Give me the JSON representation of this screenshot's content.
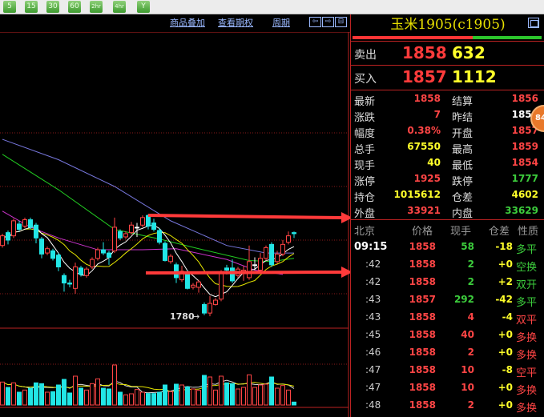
{
  "toolbar": {
    "periods": [
      "5",
      "15",
      "30",
      "60",
      "2hr",
      "4hr",
      "Y"
    ]
  },
  "chart_links": {
    "overlay": "商品叠加",
    "options": "查看期权",
    "period": "周期"
  },
  "annotation": {
    "low_label": "1780"
  },
  "colors": {
    "up": "#ff4545",
    "down": "#22e6e6",
    "ma5": "#ffffff",
    "ma10": "#e6e600",
    "ma_purple": "#cc33cc",
    "ma_green": "#22cc22",
    "ma_blue": "#7777dd",
    "arrow": "#ff3a3a"
  },
  "chart_data": {
    "type": "candlestick",
    "price_range": [
      1770,
      1975
    ],
    "gridlines": [
      1800,
      1850,
      1900,
      1950
    ],
    "candles": [
      [
        1845,
        1856,
        1843,
        1854
      ],
      [
        1857,
        1859,
        1846,
        1850
      ],
      [
        1854,
        1870,
        1852,
        1868
      ],
      [
        1865,
        1868,
        1858,
        1860
      ],
      [
        1863,
        1871,
        1861,
        1869
      ],
      [
        1869,
        1871,
        1860,
        1862
      ],
      [
        1864,
        1866,
        1847,
        1852
      ],
      [
        1851,
        1853,
        1833,
        1837
      ],
      [
        1838,
        1844,
        1836,
        1842
      ],
      [
        1840,
        1842,
        1831,
        1833
      ],
      [
        1836,
        1838,
        1821,
        1825
      ],
      [
        1817,
        1819,
        1802,
        1810
      ],
      [
        1810,
        1813,
        1806,
        1809
      ],
      [
        1805,
        1829,
        1800,
        1825
      ],
      [
        1824,
        1826,
        1816,
        1818
      ],
      [
        1817,
        1825,
        1815,
        1823
      ],
      [
        1825,
        1834,
        1823,
        1832
      ],
      [
        1833,
        1843,
        1831,
        1841
      ],
      [
        1841,
        1848,
        1836,
        1838
      ],
      [
        1838,
        1840,
        1827,
        1834
      ],
      [
        1840,
        1871,
        1838,
        1862
      ],
      [
        1858,
        1860,
        1850,
        1852
      ],
      [
        1853,
        1858,
        1851,
        1856
      ],
      [
        1857,
        1867,
        1855,
        1864
      ],
      [
        1862,
        1866,
        1853,
        1862
      ],
      [
        1864,
        1873,
        1862,
        1871
      ],
      [
        1873,
        1874,
        1860,
        1863
      ],
      [
        1866,
        1870,
        1858,
        1860
      ],
      [
        1859,
        1861,
        1846,
        1848
      ],
      [
        1847,
        1849,
        1830,
        1831
      ],
      [
        1830,
        1837,
        1828,
        1835
      ],
      [
        1827,
        1829,
        1810,
        1815
      ],
      [
        1813,
        1826,
        1811,
        1821
      ],
      [
        1820,
        1822,
        1804,
        1805
      ],
      [
        1806,
        1810,
        1804,
        1808
      ],
      [
        1806,
        1813,
        1801,
        1811
      ],
      [
        1790,
        1792,
        1780,
        1782
      ],
      [
        1782,
        1798,
        1779,
        1791
      ],
      [
        1790,
        1796,
        1789,
        1794
      ],
      [
        1795,
        1822,
        1793,
        1820
      ],
      [
        1824,
        1827,
        1818,
        1822
      ],
      [
        1824,
        1832,
        1810,
        1812
      ],
      [
        1817,
        1825,
        1815,
        1823
      ],
      [
        1821,
        1826,
        1812,
        1822
      ],
      [
        1815,
        1845,
        1813,
        1830
      ],
      [
        1827,
        1834,
        1822,
        1827
      ],
      [
        1822,
        1838,
        1820,
        1833
      ],
      [
        1833,
        1845,
        1831,
        1843
      ],
      [
        1846,
        1848,
        1825,
        1827
      ],
      [
        1830,
        1840,
        1828,
        1837
      ],
      [
        1837,
        1850,
        1835,
        1846
      ],
      [
        1848,
        1858,
        1846,
        1854
      ],
      [
        1857,
        1858,
        1852,
        1856
      ]
    ],
    "volumes": [
      86,
      66,
      83,
      48,
      56,
      63,
      83,
      80,
      48,
      50,
      75,
      96,
      45,
      108,
      63,
      56,
      80,
      98,
      63,
      60,
      150,
      48,
      38,
      42,
      58,
      48,
      43,
      43,
      48,
      75,
      50,
      78,
      75,
      68,
      60,
      55,
      111,
      105,
      56,
      108,
      83,
      80,
      60,
      66,
      113,
      66,
      75,
      78,
      105,
      63,
      73,
      56,
      11
    ],
    "ma_purple": [
      [
        0,
        1877
      ],
      [
        5,
        1862
      ],
      [
        10,
        1852
      ],
      [
        17,
        1841
      ],
      [
        25,
        1841
      ],
      [
        31,
        1842
      ],
      [
        40,
        1832
      ],
      [
        45,
        1822
      ],
      [
        50,
        1818
      ]
    ],
    "ma_green": [
      [
        0,
        1930
      ],
      [
        10,
        1897
      ],
      [
        20,
        1860
      ],
      [
        28,
        1851
      ],
      [
        35,
        1842
      ],
      [
        44,
        1831
      ],
      [
        48,
        1830
      ],
      [
        52,
        1833
      ]
    ],
    "ma_blue": [
      [
        0,
        1944
      ],
      [
        10,
        1925
      ],
      [
        20,
        1900
      ],
      [
        30,
        1868
      ],
      [
        40,
        1845
      ],
      [
        47,
        1838
      ],
      [
        52,
        1838
      ]
    ]
  },
  "quote": {
    "title": "玉米1905(c1905)",
    "ask": {
      "label": "卖出",
      "price": "1858",
      "vol": "632"
    },
    "bid": {
      "label": "买入",
      "price": "1857",
      "vol": "1112"
    },
    "stats": [
      {
        "l1": "最新",
        "v1": "1858",
        "c1": "r",
        "l2": "结算",
        "v2": "1856",
        "c2": "r"
      },
      {
        "l1": "涨跌",
        "v1": "7",
        "c1": "r",
        "l2": "昨结",
        "v2": "1851",
        "c2": "w"
      },
      {
        "l1": "幅度",
        "v1": "0.38%",
        "c1": "r",
        "l2": "开盘",
        "v2": "1857",
        "c2": "r"
      },
      {
        "l1": "总手",
        "v1": "67550",
        "c1": "y",
        "l2": "最高",
        "v2": "1859",
        "c2": "r"
      },
      {
        "l1": "现手",
        "v1": "40",
        "c1": "y",
        "l2": "最低",
        "v2": "1854",
        "c2": "r"
      },
      {
        "l1": "涨停",
        "v1": "1925",
        "c1": "r",
        "l2": "跌停",
        "v2": "1777",
        "c2": "g"
      },
      {
        "l1": "持仓",
        "v1": "1015612",
        "c1": "y",
        "l2": "仓差",
        "v2": "4602",
        "c2": "y"
      },
      {
        "l1": "外盘",
        "v1": "33921",
        "c1": "r",
        "l2": "内盘",
        "v2": "33629",
        "c2": "g"
      }
    ],
    "badge": "84"
  },
  "ticks": {
    "headers": [
      "北京",
      "价格",
      "现手",
      "仓差",
      "性质"
    ],
    "rows": [
      {
        "t": "09:15",
        "p": "1858",
        "pc": "r",
        "v": "58",
        "vc": "g",
        "d": "-18",
        "n": "多平",
        "nc": "g"
      },
      {
        "t": ":42",
        "p": "1858",
        "pc": "r",
        "v": "2",
        "vc": "g",
        "d": "+0",
        "n": "空换",
        "nc": "g"
      },
      {
        "t": ":42",
        "p": "1858",
        "pc": "r",
        "v": "2",
        "vc": "g",
        "d": "+2",
        "n": "双开",
        "nc": "g"
      },
      {
        "t": ":43",
        "p": "1857",
        "pc": "r",
        "v": "292",
        "vc": "g",
        "d": "-42",
        "n": "多平",
        "nc": "g"
      },
      {
        "t": ":43",
        "p": "1858",
        "pc": "r",
        "v": "4",
        "vc": "r",
        "d": "-4",
        "n": "双平",
        "nc": "r"
      },
      {
        "t": ":45",
        "p": "1858",
        "pc": "r",
        "v": "40",
        "vc": "r",
        "d": "+0",
        "n": "多换",
        "nc": "r"
      },
      {
        "t": ":46",
        "p": "1858",
        "pc": "r",
        "v": "2",
        "vc": "r",
        "d": "+0",
        "n": "多换",
        "nc": "r"
      },
      {
        "t": ":47",
        "p": "1858",
        "pc": "r",
        "v": "10",
        "vc": "r",
        "d": "-8",
        "n": "空平",
        "nc": "r"
      },
      {
        "t": ":47",
        "p": "1858",
        "pc": "r",
        "v": "10",
        "vc": "r",
        "d": "+0",
        "n": "多换",
        "nc": "r"
      },
      {
        "t": ":48",
        "p": "1858",
        "pc": "r",
        "v": "2",
        "vc": "r",
        "d": "+0",
        "n": "多换",
        "nc": "r"
      }
    ]
  }
}
